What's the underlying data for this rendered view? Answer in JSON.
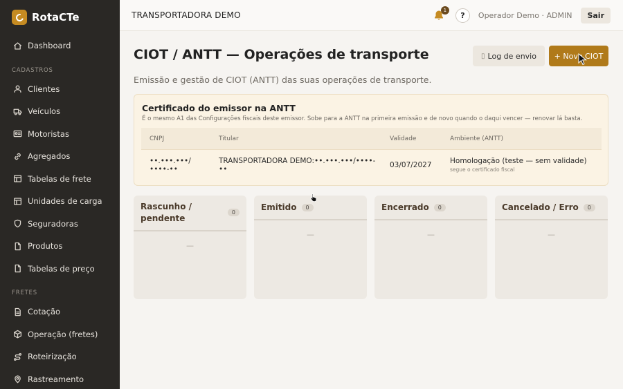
{
  "brand": {
    "name": "RotaCTe"
  },
  "sidebar": {
    "items_top": [
      {
        "label": "Dashboard",
        "icon": "home-icon"
      }
    ],
    "sections": [
      {
        "title": "CADASTROS",
        "items": [
          {
            "label": "Clientes",
            "icon": "user-icon"
          },
          {
            "label": "Veículos",
            "icon": "truck-icon"
          },
          {
            "label": "Motoristas",
            "icon": "id-card-icon"
          },
          {
            "label": "Agregados",
            "icon": "link-icon"
          },
          {
            "label": "Tabelas de frete",
            "icon": "table-icon"
          },
          {
            "label": "Unidades de carga",
            "icon": "container-icon"
          },
          {
            "label": "Seguradoras",
            "icon": "shield-icon"
          },
          {
            "label": "Produtos",
            "icon": "file-icon"
          },
          {
            "label": "Tabelas de preço",
            "icon": "file-icon"
          }
        ]
      },
      {
        "title": "FRETES",
        "items": [
          {
            "label": "Cotação",
            "icon": "document-icon"
          },
          {
            "label": "Operação (fretes)",
            "icon": "box-icon"
          },
          {
            "label": "Roteirização",
            "icon": "route-icon"
          },
          {
            "label": "Rastreamento",
            "icon": "map-pin-icon"
          }
        ]
      }
    ]
  },
  "topbar": {
    "company": "TRANSPORTADORA DEMO",
    "notifications_count": "1",
    "help_label": "?",
    "user": "Operador Demo · ADMIN",
    "logout_label": "Sair"
  },
  "page": {
    "title": "CIOT / ANTT — Operações de transporte",
    "subtitle": "Emissão e gestão de CIOT (ANTT) das suas operações de transporte.",
    "log_button": "Log de envio",
    "new_button": "+ Novo CIOT"
  },
  "certificate": {
    "title": "Certificado do emissor na ANTT",
    "description": "É o mesmo A1 das Configurações fiscais deste emissor. Sobe para a ANTT na primeira emissão e de novo quando o daqui vencer — renovar lá basta.",
    "columns": [
      "CNPJ",
      "Titular",
      "Validade",
      "Ambiente (ANTT)"
    ],
    "row": {
      "cnpj": "••.•••.•••/••••-••",
      "holder": "TRANSPORTADORA DEMO:••.•••.•••/••••-••",
      "validity": "03/07/2027",
      "environment": "Homologação (teste — sem validade)",
      "environment_note": "segue o certificado fiscal"
    }
  },
  "board": {
    "columns": [
      {
        "label": "Rascunho / pendente",
        "count": "0",
        "empty": "—"
      },
      {
        "label": "Emitido",
        "count": "0",
        "empty": "—"
      },
      {
        "label": "Encerrado",
        "count": "0",
        "empty": "—"
      },
      {
        "label": "Cancelado / Erro",
        "count": "0",
        "empty": "—"
      }
    ]
  }
}
